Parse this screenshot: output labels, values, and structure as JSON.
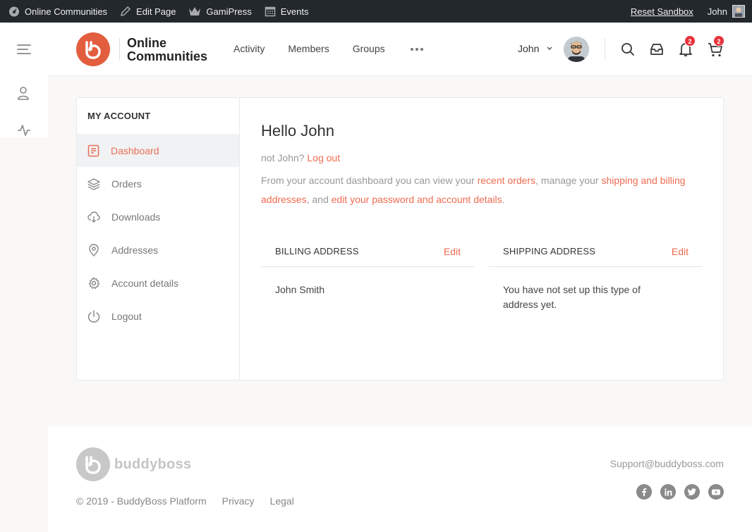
{
  "adminbar": {
    "items": [
      {
        "label": "Online Communities",
        "icon": "dashboard-icon"
      },
      {
        "label": "Edit Page",
        "icon": "pencil-icon"
      },
      {
        "label": "GamiPress",
        "icon": "crown-icon"
      },
      {
        "label": "Events",
        "icon": "calendar-icon"
      }
    ],
    "reset": "Reset Sandbox",
    "user": "John"
  },
  "header": {
    "logo_line1": "Online",
    "logo_line2": "Communities",
    "nav": [
      "Activity",
      "Members",
      "Groups"
    ],
    "user_name": "John",
    "notifications_count": "2",
    "cart_count": "2"
  },
  "account": {
    "title": "MY ACCOUNT",
    "menu": [
      "Dashboard",
      "Orders",
      "Downloads",
      "Addresses",
      "Account details",
      "Logout"
    ],
    "active_item": "Dashboard"
  },
  "content": {
    "hello": "Hello John",
    "not_user": "not John?",
    "logout_link": "Log out",
    "intro_1": "From your account dashboard you can view your",
    "link_orders": "recent orders",
    "intro_2": ", manage your",
    "link_addresses": "shipping and billing addresses",
    "intro_3": ", and",
    "link_details": "edit your password and account details",
    "intro_4": "."
  },
  "billing": {
    "title": "BILLING ADDRESS",
    "edit": "Edit",
    "body": "John Smith"
  },
  "shipping": {
    "title": "SHIPPING ADDRESS",
    "edit": "Edit",
    "body": "You have not set up this type of address yet."
  },
  "footer": {
    "brand": "buddyboss",
    "copyright": "©  2019 - BuddyBoss Platform",
    "links": [
      "Privacy",
      "Legal"
    ],
    "support": "Support@buddyboss.com",
    "social": [
      "facebook-icon",
      "linkedin-icon",
      "twitter-icon",
      "youtube-icon"
    ]
  },
  "colors": {
    "accent": "#ef6c52",
    "logo": "#e25e3e",
    "adminbar": "#23282d",
    "badge": "#e8323c"
  }
}
